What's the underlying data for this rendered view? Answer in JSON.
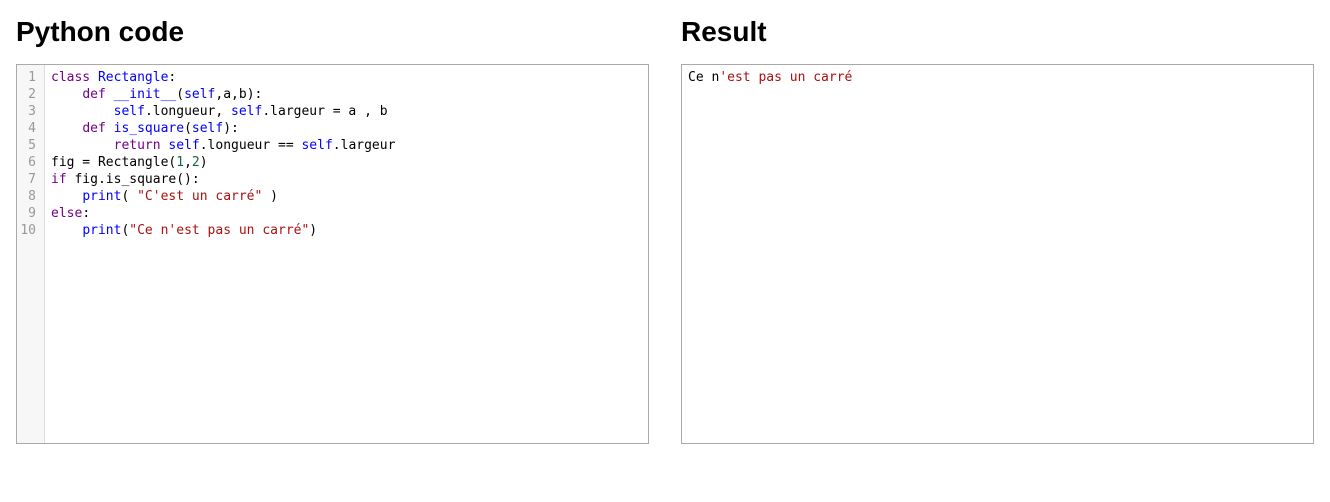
{
  "left_panel": {
    "title": "Python code",
    "code_lines": [
      [
        {
          "t": "kw",
          "s": "class"
        },
        {
          "t": "plain",
          "s": " "
        },
        {
          "t": "def",
          "s": "Rectangle"
        },
        {
          "t": "plain",
          "s": ":"
        }
      ],
      [
        {
          "t": "plain",
          "s": "    "
        },
        {
          "t": "kw",
          "s": "def"
        },
        {
          "t": "plain",
          "s": " "
        },
        {
          "t": "def",
          "s": "__init__"
        },
        {
          "t": "plain",
          "s": "("
        },
        {
          "t": "def",
          "s": "self"
        },
        {
          "t": "plain",
          "s": ",a,b):"
        }
      ],
      [
        {
          "t": "plain",
          "s": "        "
        },
        {
          "t": "def",
          "s": "self"
        },
        {
          "t": "plain",
          "s": ".longueur, "
        },
        {
          "t": "def",
          "s": "self"
        },
        {
          "t": "plain",
          "s": ".largeur = a , b"
        }
      ],
      [
        {
          "t": "plain",
          "s": "    "
        },
        {
          "t": "kw",
          "s": "def"
        },
        {
          "t": "plain",
          "s": " "
        },
        {
          "t": "def",
          "s": "is_square"
        },
        {
          "t": "plain",
          "s": "("
        },
        {
          "t": "def",
          "s": "self"
        },
        {
          "t": "plain",
          "s": "):"
        }
      ],
      [
        {
          "t": "plain",
          "s": "        "
        },
        {
          "t": "kw",
          "s": "return"
        },
        {
          "t": "plain",
          "s": " "
        },
        {
          "t": "def",
          "s": "self"
        },
        {
          "t": "plain",
          "s": ".longueur == "
        },
        {
          "t": "def",
          "s": "self"
        },
        {
          "t": "plain",
          "s": ".largeur"
        }
      ],
      [
        {
          "t": "plain",
          "s": "fig = Rectangle("
        },
        {
          "t": "num",
          "s": "1"
        },
        {
          "t": "plain",
          "s": ","
        },
        {
          "t": "num",
          "s": "2"
        },
        {
          "t": "plain",
          "s": ")"
        }
      ],
      [
        {
          "t": "kw",
          "s": "if"
        },
        {
          "t": "plain",
          "s": " fig.is_square():"
        }
      ],
      [
        {
          "t": "plain",
          "s": "    "
        },
        {
          "t": "def",
          "s": "print"
        },
        {
          "t": "plain",
          "s": "( "
        },
        {
          "t": "str",
          "s": "\"C'est un carré\""
        },
        {
          "t": "plain",
          "s": " )"
        }
      ],
      [
        {
          "t": "kw",
          "s": "else"
        },
        {
          "t": "plain",
          "s": ":"
        }
      ],
      [
        {
          "t": "plain",
          "s": "    "
        },
        {
          "t": "def",
          "s": "print"
        },
        {
          "t": "plain",
          "s": "("
        },
        {
          "t": "str",
          "s": "\"Ce n'est pas un carré\""
        },
        {
          "t": "plain",
          "s": ")"
        }
      ]
    ]
  },
  "right_panel": {
    "title": "Result",
    "output_tokens": [
      {
        "t": "plain",
        "s": "Ce n"
      },
      {
        "t": "str",
        "s": "'est pas un carré"
      }
    ]
  }
}
